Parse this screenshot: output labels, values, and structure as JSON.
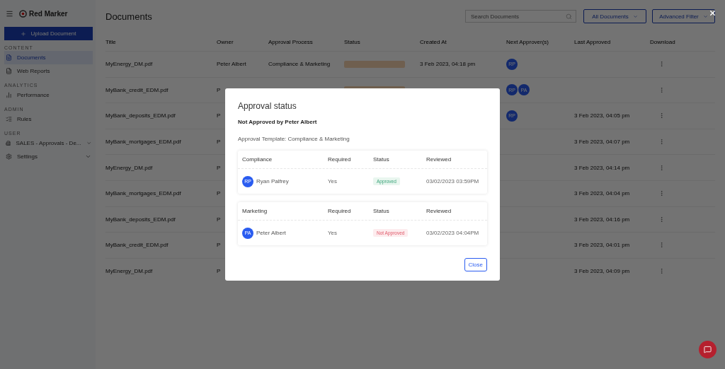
{
  "app": {
    "logo": "Red Marker",
    "upload_button": "Upload Document"
  },
  "sidebar": {
    "sections": [
      {
        "label": "CONTENT",
        "items": [
          {
            "label": "Documents",
            "selected": true,
            "expandable": false
          },
          {
            "label": "Web Reports",
            "selected": false,
            "expandable": false
          }
        ]
      },
      {
        "label": "ANALYTICS",
        "items": [
          {
            "label": "Performance",
            "selected": false,
            "expandable": false
          }
        ]
      },
      {
        "label": "ADMIN",
        "items": [
          {
            "label": "Rules",
            "selected": false,
            "expandable": false
          }
        ]
      },
      {
        "label": "USER",
        "items": [
          {
            "label": "SALES - Approvals - De...",
            "selected": false,
            "expandable": true
          },
          {
            "label": "Settings",
            "selected": false,
            "expandable": true
          }
        ]
      }
    ]
  },
  "header": {
    "title": "Documents",
    "search": {
      "placeholder": "Search Documents"
    },
    "filters": [
      "All Documents",
      "Advanced Filter"
    ]
  },
  "table": {
    "columns": [
      "Title",
      "Owner",
      "Approval Process",
      "Status",
      "Created At",
      "Next Approver(s)",
      "Last Approved",
      "Download"
    ],
    "rows": [
      {
        "title": "MyEnergy_DM.pdf",
        "owner": "Peter Albert",
        "process": "Compliance & Marketing",
        "status_badge": true,
        "created": "3 Feb 2023, 04:18 pm",
        "approvers": [
          "RP"
        ],
        "last_approved": ""
      },
      {
        "title": "MyBank_credit_EDM.pdf",
        "owner": "P",
        "process": "",
        "status_badge": true,
        "created": "",
        "approvers": [
          "RP",
          "PA"
        ],
        "last_approved": ""
      },
      {
        "title": "MyBank_deposits_EDM.pdf",
        "owner": "P",
        "process": "",
        "status_badge": false,
        "created": "",
        "approvers": [
          "RP"
        ],
        "last_approved": "3 Feb 2023, 04:05 pm"
      },
      {
        "title": "MyBank_mortgages_EDM.pdf",
        "owner": "P",
        "process": "",
        "status_badge": false,
        "created": "",
        "approvers": [],
        "last_approved": "3 Feb 2023, 04:07 pm"
      },
      {
        "title": "MyEnergy_DM.pdf",
        "owner": "P",
        "process": "",
        "status_badge": false,
        "created": "",
        "approvers": [],
        "last_approved": "3 Feb 2023, 04:14 pm"
      },
      {
        "title": "MyBank_mortgages_EDM.pdf",
        "owner": "P",
        "process": "",
        "status_badge": false,
        "created": "",
        "approvers": [],
        "last_approved": "3 Feb 2023, 04:04 pm"
      },
      {
        "title": "MyBank_deposits_EDM.pdf",
        "owner": "P",
        "process": "",
        "status_badge": false,
        "created": "",
        "approvers": [],
        "last_approved": "3 Feb 2023, 04:16 pm"
      },
      {
        "title": "MyBank_credit_EDM.pdf",
        "owner": "P",
        "process": "",
        "status_badge": false,
        "created": "",
        "approvers": [],
        "last_approved": "3 Feb 2023, 04:01 pm"
      },
      {
        "title": "MyEnergy_DM.pdf",
        "owner": "P",
        "process": "",
        "status_badge": false,
        "created": "",
        "approvers": [],
        "last_approved": "3 Feb 2023, 04:09 pm"
      }
    ]
  },
  "modal": {
    "title": "Approval status",
    "summary": "Not Approved by Peter Albert",
    "template": "Approval Template: Compliance & Marketing",
    "groups": [
      {
        "columns": [
          "Compliance",
          "Required",
          "Status",
          "Reviewed"
        ],
        "rows": [
          {
            "initials": "RP",
            "name": "Ryan Palfrey",
            "required": "Yes",
            "status": "Approved",
            "kind": "approved",
            "reviewed": "03/02/2023 03:59PM"
          }
        ]
      },
      {
        "columns": [
          "Marketing",
          "Required",
          "Status",
          "Reviewed"
        ],
        "rows": [
          {
            "initials": "PA",
            "name": "Peter Albert",
            "required": "Yes",
            "status": "Not Approved",
            "kind": "rejected",
            "reviewed": "03/02/2023 04:04PM"
          }
        ]
      }
    ],
    "close_button": "Close"
  }
}
